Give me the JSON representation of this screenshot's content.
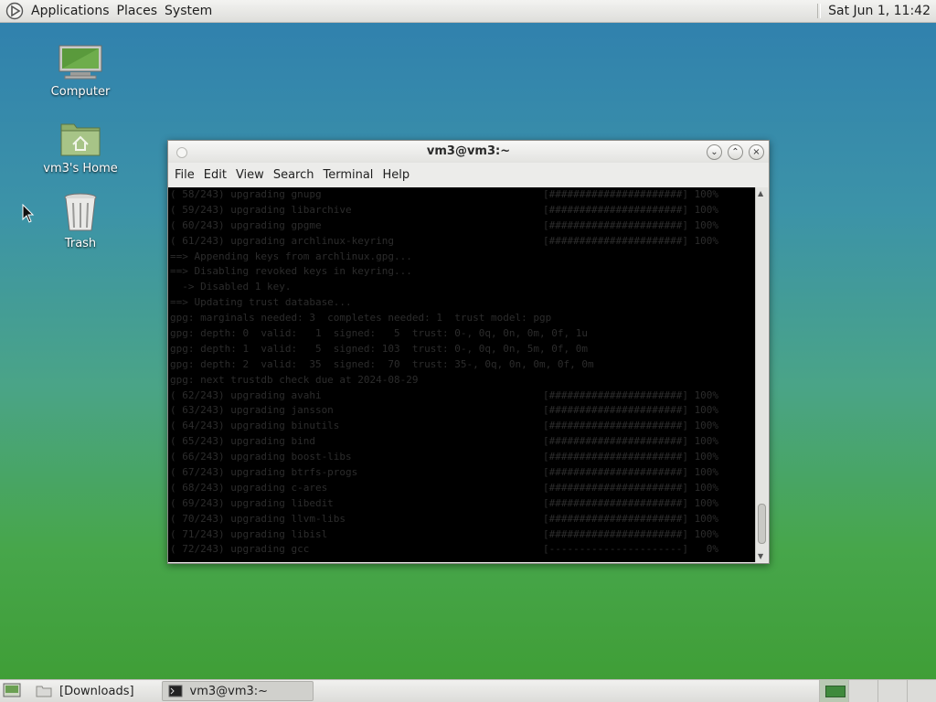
{
  "top_panel": {
    "menus": [
      "Applications",
      "Places",
      "System"
    ],
    "clock": "Sat Jun  1, 11:42"
  },
  "desktop_icons": [
    {
      "label": "Computer"
    },
    {
      "label": "vm3's Home"
    },
    {
      "label": "Trash"
    }
  ],
  "window": {
    "title": "vm3@vm3:~",
    "menu": [
      "File",
      "Edit",
      "View",
      "Search",
      "Terminal",
      "Help"
    ],
    "controls": {
      "minimize": "⌄",
      "maximize": "⌃",
      "close": "×"
    }
  },
  "terminal": {
    "lines": [
      {
        "text": "( 58/243) upgrading gnupg",
        "progress": "[######################] 100%"
      },
      {
        "text": "( 59/243) upgrading libarchive",
        "progress": "[######################] 100%"
      },
      {
        "text": "( 60/243) upgrading gpgme",
        "progress": "[######################] 100%"
      },
      {
        "text": "( 61/243) upgrading archlinux-keyring",
        "progress": "[######################] 100%"
      },
      {
        "text": "==> Appending keys from archlinux.gpg...",
        "progress": ""
      },
      {
        "text": "==> Disabling revoked keys in keyring...",
        "progress": ""
      },
      {
        "text": "  -> Disabled 1 key.",
        "progress": ""
      },
      {
        "text": "==> Updating trust database...",
        "progress": ""
      },
      {
        "text": "gpg: marginals needed: 3  completes needed: 1  trust model: pgp",
        "progress": ""
      },
      {
        "text": "gpg: depth: 0  valid:   1  signed:   5  trust: 0-, 0q, 0n, 0m, 0f, 1u",
        "progress": ""
      },
      {
        "text": "gpg: depth: 1  valid:   5  signed: 103  trust: 0-, 0q, 0n, 5m, 0f, 0m",
        "progress": ""
      },
      {
        "text": "gpg: depth: 2  valid:  35  signed:  70  trust: 35-, 0q, 0n, 0m, 0f, 0m",
        "progress": ""
      },
      {
        "text": "gpg: next trustdb check due at 2024-08-29",
        "progress": ""
      },
      {
        "text": "( 62/243) upgrading avahi",
        "progress": "[######################] 100%"
      },
      {
        "text": "( 63/243) upgrading jansson",
        "progress": "[######################] 100%"
      },
      {
        "text": "( 64/243) upgrading binutils",
        "progress": "[######################] 100%"
      },
      {
        "text": "( 65/243) upgrading bind",
        "progress": "[######################] 100%"
      },
      {
        "text": "( 66/243) upgrading boost-libs",
        "progress": "[######################] 100%"
      },
      {
        "text": "( 67/243) upgrading btrfs-progs",
        "progress": "[######################] 100%"
      },
      {
        "text": "( 68/243) upgrading c-ares",
        "progress": "[######################] 100%"
      },
      {
        "text": "( 69/243) upgrading libedit",
        "progress": "[######################] 100%"
      },
      {
        "text": "( 70/243) upgrading llvm-libs",
        "progress": "[######################] 100%"
      },
      {
        "text": "( 71/243) upgrading libisl",
        "progress": "[######################] 100%"
      },
      {
        "text": "( 72/243) upgrading gcc",
        "progress": "[----------------------]   0%"
      }
    ]
  },
  "bottom_panel": {
    "tasks": [
      {
        "label": "[Downloads]"
      },
      {
        "label": "vm3@vm3:~"
      }
    ]
  },
  "colors": {
    "terminal_bg": "#000000",
    "terminal_fg": "#2c2c2c",
    "panel_bg": "#e6e6e3"
  }
}
